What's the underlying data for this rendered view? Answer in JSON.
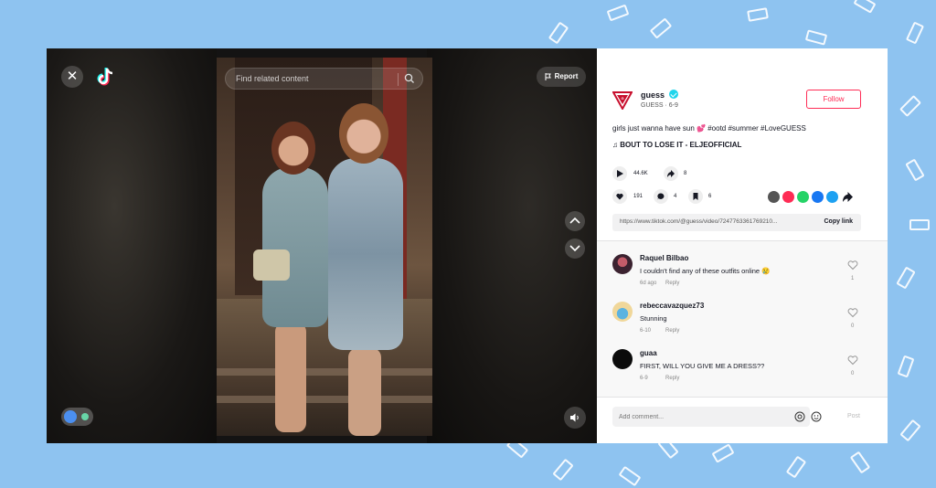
{
  "video": {
    "search_placeholder": "Find related content",
    "report_label": "Report",
    "icons": [
      "close-icon",
      "tiktok-logo-icon",
      "search-icon",
      "flag-icon",
      "chevron-up-icon",
      "chevron-down-icon",
      "volume-icon"
    ]
  },
  "author": {
    "username": "guess",
    "handle_date": "GUESS · 6-9",
    "follow_label": "Follow"
  },
  "post": {
    "caption": "girls just wanna have sun 💕 #ootd #summer #LoveGUESS",
    "music": "♫  BOUT TO LOSE IT - ELJEOFFICIAL",
    "plays": "44.6K",
    "shares": "8",
    "likes": "191",
    "comments": "4",
    "saves": "6",
    "link": "https://www.tiktok.com/@guess/video/7247763361769210...",
    "copy_label": "Copy link"
  },
  "comments": [
    {
      "name": "Raquel Bilbao",
      "text": "I couldn't find any of these outfits online 😢",
      "date": "6d ago",
      "reply": "Reply",
      "likes": "1"
    },
    {
      "name": "rebeccavazquez73",
      "text": "Stunning",
      "date": "6-10",
      "reply": "Reply",
      "likes": "0"
    },
    {
      "name": "guaa",
      "text": "FIRST, WILL YOU GIVE ME A DRESS??",
      "date": "6-9",
      "reply": "Reply",
      "likes": "0"
    }
  ],
  "composer": {
    "placeholder": "Add comment...",
    "post_label": "Post"
  },
  "colors": {
    "accent": "#fe2c55",
    "background": "#8ec3f0",
    "verified": "#20d5ec"
  }
}
